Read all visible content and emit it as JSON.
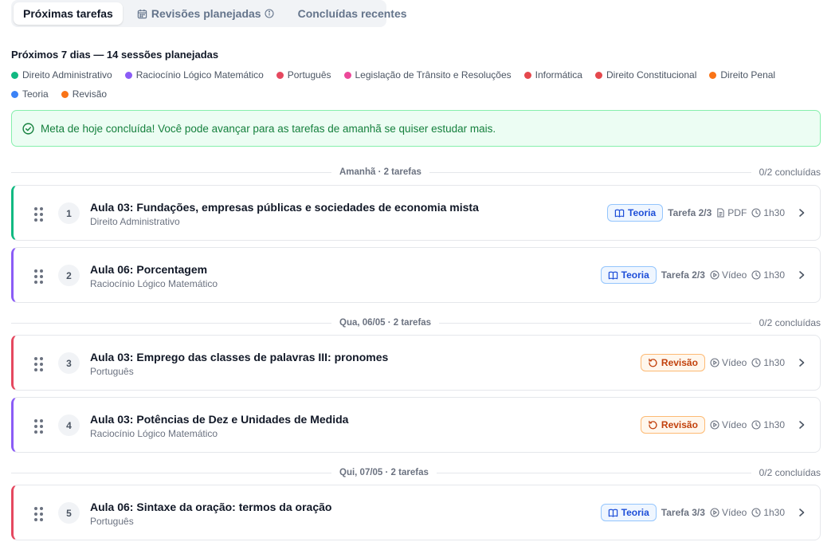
{
  "tabs": [
    {
      "label": "Próximas tarefas"
    },
    {
      "label": "Revisões planejadas"
    },
    {
      "label": "Concluídas recentes"
    }
  ],
  "summary": "Próximos 7 dias — 14 sessões planejadas",
  "legend": [
    {
      "label": "Direito Administrativo",
      "color": "#10b981"
    },
    {
      "label": "Raciocínio Lógico Matemático",
      "color": "#8b5cf6"
    },
    {
      "label": "Português",
      "color": "#e5485f"
    },
    {
      "label": "Legislação de Trânsito e Resoluções",
      "color": "#ec4899"
    },
    {
      "label": "Informática",
      "color": "#e5484d"
    },
    {
      "label": "Direito Constitucional",
      "color": "#e5484d"
    },
    {
      "label": "Direito Penal",
      "color": "#f97316"
    },
    {
      "label": "Teoria",
      "color": "#3b82f6"
    },
    {
      "label": "Revisão",
      "color": "#f97316"
    }
  ],
  "banner": "Meta de hoje concluída! Você pode avançar para as tarefas de amanhã se quiser estudar mais.",
  "groups": [
    {
      "label": "Amanhã · 2 tarefas",
      "progress": "0/2 concluídas"
    },
    {
      "label": "Qua, 06/05 · 2 tarefas",
      "progress": "0/2 concluídas"
    },
    {
      "label": "Qui, 07/05 · 2 tarefas",
      "progress": "0/2 concluídas"
    }
  ],
  "tasks": [
    {
      "number": "1",
      "title": "Aula 03: Fundações, empresas públicas e sociedades de economia mista",
      "subject": "Direito Administrativo",
      "color": "#10b981",
      "type": "Teoria",
      "step": "Tarefa 2/3",
      "media": "PDF",
      "media_icon": "file-icon",
      "duration": "1h30"
    },
    {
      "number": "2",
      "title": "Aula 06: Porcentagem",
      "subject": "Raciocínio Lógico Matemático",
      "color": "#8b5cf6",
      "type": "Teoria",
      "step": "Tarefa 2/3",
      "media": "Vídeo",
      "media_icon": "play-icon",
      "duration": "1h30"
    },
    {
      "number": "3",
      "title": "Aula 03: Emprego das classes de palavras III: pronomes",
      "subject": "Português",
      "color": "#e5485f",
      "type": "Revisão",
      "step": "",
      "media": "Vídeo",
      "media_icon": "play-icon",
      "duration": "1h30"
    },
    {
      "number": "4",
      "title": "Aula 03: Potências de Dez e Unidades de Medida",
      "subject": "Raciocínio Lógico Matemático",
      "color": "#8b5cf6",
      "type": "Revisão",
      "step": "",
      "media": "Vídeo",
      "media_icon": "play-icon",
      "duration": "1h30"
    },
    {
      "number": "5",
      "title": "Aula 06: Sintaxe da oração: termos da oração",
      "subject": "Português",
      "color": "#e5485f",
      "type": "Teoria",
      "step": "Tarefa 3/3",
      "media": "Vídeo",
      "media_icon": "play-icon",
      "duration": "1h30"
    }
  ]
}
